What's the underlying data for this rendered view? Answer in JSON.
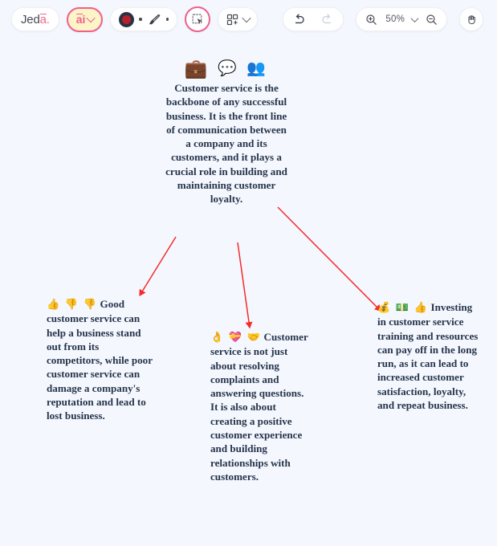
{
  "app": {
    "logo_prefix": "Je",
    "logo_bar": "a",
    "logo_suffix": "d",
    "logo_dot": ".",
    "logo_full": "Jeda."
  },
  "toolbar": {
    "ai_button_label": "ai",
    "ai_button_icon": "chevron-down-icon",
    "shape_tool_icon": "filled-circle-icon",
    "brush_tool_icon": "paintbrush-icon",
    "select_tool_icon": "selection-cursor-icon",
    "templates_icon": "add-grid-icon",
    "templates_chevron_icon": "chevron-down-icon",
    "undo_icon": "undo-arrow-icon",
    "redo_icon": "redo-arrow-icon",
    "zoom_in_icon": "zoom-in-magnifier-icon",
    "zoom_out_icon": "zoom-out-magnifier-icon",
    "zoom_level": "50%",
    "zoom_chevron_icon": "chevron-down-icon",
    "pan_icon": "hand-icon"
  },
  "canvas": {
    "background_color": "#f4f7fd",
    "arrow_color": "#f42b2b",
    "text_color": "#26354c",
    "nodes": {
      "center": {
        "emojis": "💼 💬 👥",
        "text": "Customer service is the backbone of any successful business. It is the front line of communication between a company and its customers, and it plays a crucial role in building and maintaining customer loyalty."
      },
      "left": {
        "emojis": "👍 👎 👎",
        "text": "Good customer service can help a business stand out from its competitors, while poor customer service can damage a company's reputation and lead to lost business."
      },
      "middle": {
        "emojis": "👌 💝 🤝",
        "text": "Customer service is not just about resolving complaints and answering questions. It is also about creating a positive customer experience and building relationships with customers."
      },
      "right": {
        "emojis": "💰 💵 👍",
        "text": "Investing in customer service training and resources can pay off in the long run, as it can lead to increased customer satisfaction, loyalty, and repeat business."
      }
    }
  }
}
